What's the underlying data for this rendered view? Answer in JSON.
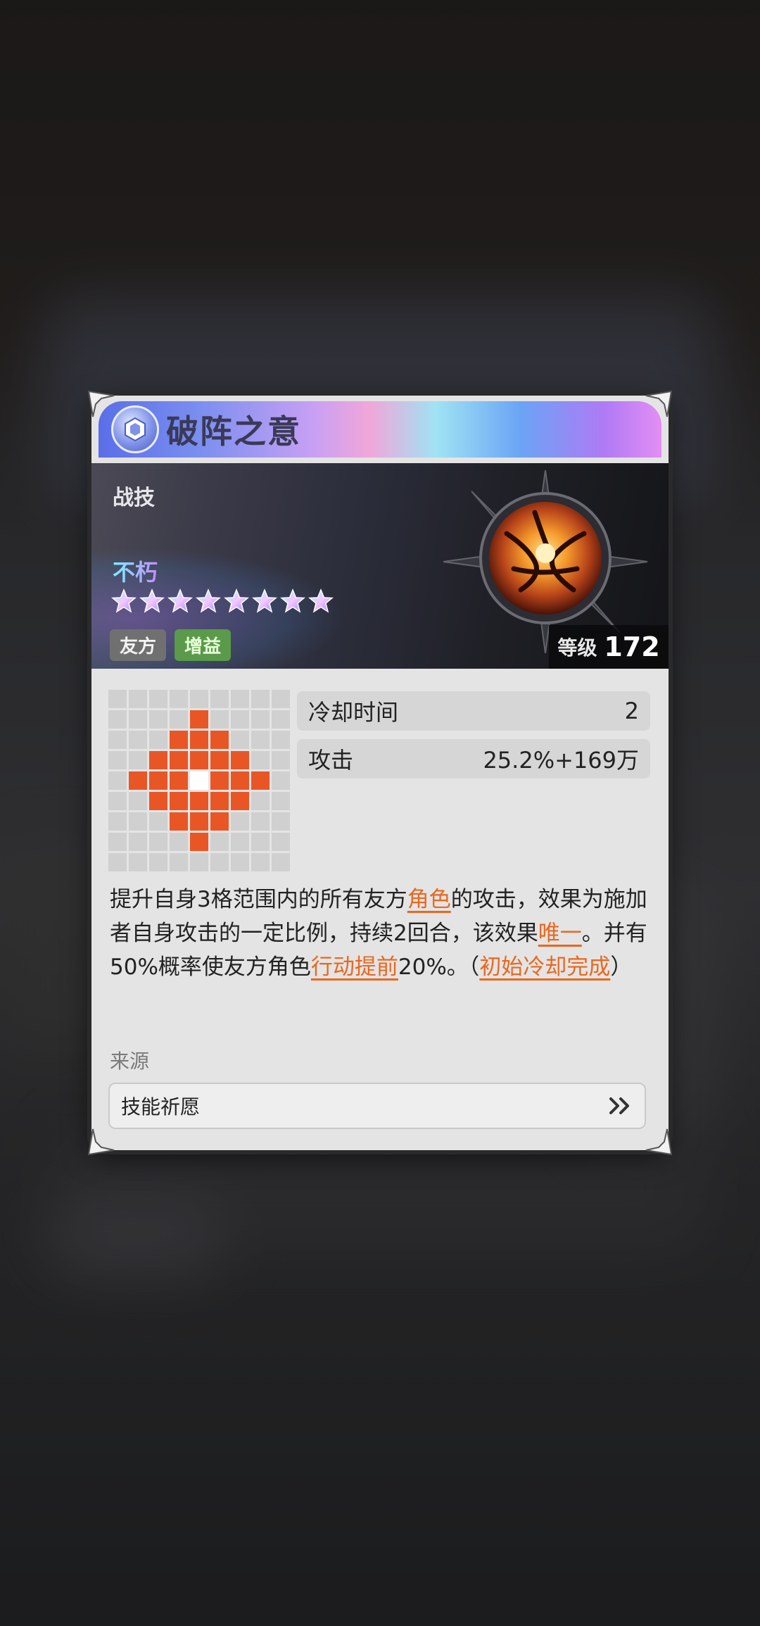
{
  "skill": {
    "name": "破阵之意",
    "type": "战技",
    "rank": "不朽",
    "stars": 8,
    "tags": [
      "友方",
      "增益"
    ],
    "level_label": "等级",
    "level_value": "172"
  },
  "stats": [
    {
      "label": "冷却时间",
      "value": "2"
    },
    {
      "label": "攻击",
      "value": "25.2%+169万"
    }
  ],
  "range_grid": {
    "size": 9,
    "pattern": [
      "000000000",
      "000010000",
      "000111000",
      "001111100",
      "011121110",
      "001111100",
      "000111000",
      "000010000",
      "000000000"
    ]
  },
  "description": {
    "p1": "提升自身3格范围内的所有友方",
    "k1": "角色",
    "p2": "的攻击，效果为施加者自身攻击的一定比例，持续2回合，该效果",
    "k2": "唯一",
    "p3": "。并有50%概率使友方角色",
    "k3": "行动提前",
    "p4": "20%。（",
    "k4": "初始冷却完成",
    "p5": "）"
  },
  "source": {
    "label": "来源",
    "button": "技能祈愿",
    "icon": "double-chevron-right-icon"
  },
  "colors": {
    "highlight": "#e86820",
    "grid_on": "#e95626",
    "tag_buff": "#5a9a4a"
  }
}
